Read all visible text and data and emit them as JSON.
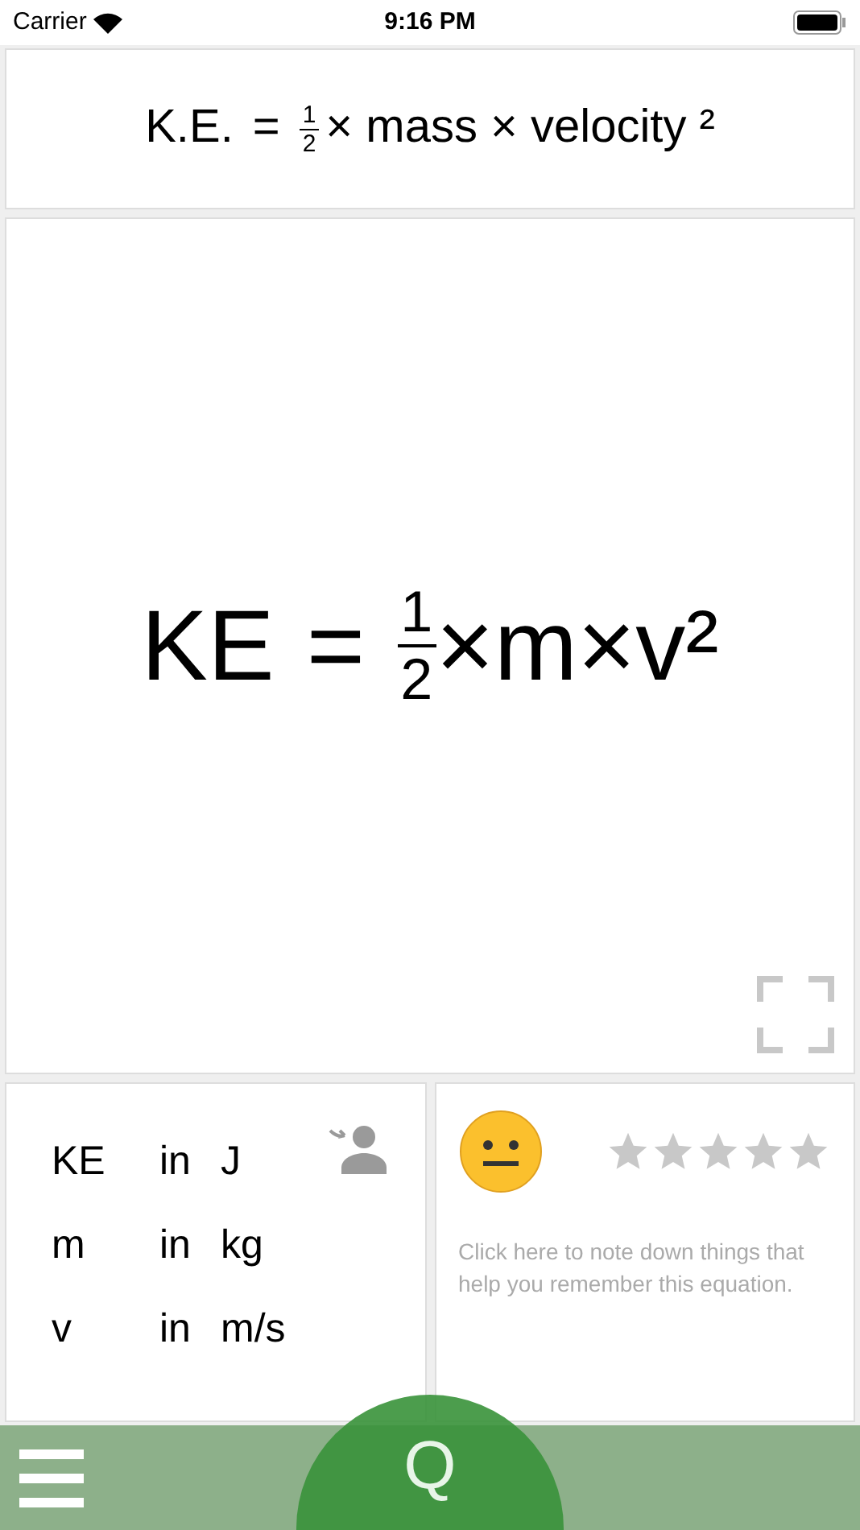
{
  "status_bar": {
    "carrier": "Carrier",
    "time": "9:16 PM"
  },
  "word_equation": {
    "lhs": "K.E.",
    "equals": "=",
    "numerator": "1",
    "denominator": "2",
    "rhs": "× mass × velocity ²"
  },
  "symbol_equation": {
    "lhs": "KE",
    "equals": "=",
    "numerator": "1",
    "denominator": "2",
    "rhs": "×m×v²"
  },
  "variables": [
    {
      "symbol": "KE",
      "in": "in",
      "unit": "J"
    },
    {
      "symbol": "m",
      "in": "in",
      "unit": "kg"
    },
    {
      "symbol": "v",
      "in": "in",
      "unit": "m/s"
    }
  ],
  "rating": {
    "stars": 0
  },
  "notes": {
    "placeholder": "Click here to note down things that help you remember this equation."
  },
  "quiz_button": {
    "label": "Q"
  }
}
